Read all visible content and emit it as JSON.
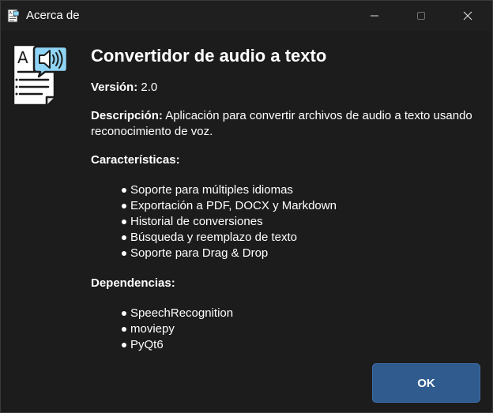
{
  "window": {
    "title": "Acerca de"
  },
  "about": {
    "app_name": "Convertidor de audio a texto",
    "version_label": "Versión:",
    "version_value": "2.0",
    "description_label": "Descripción:",
    "description_text": "Aplicación para convertir archivos de audio a texto usando reconocimiento de voz.",
    "features_title": "Características:",
    "features": [
      "Soporte para múltiples idiomas",
      "Exportación a PDF, DOCX y Markdown",
      "Historial de conversiones",
      "Búsqueda y reemplazo de texto",
      "Soporte para Drag & Drop"
    ],
    "dependencies_title": "Dependencias:",
    "dependencies": [
      "SpeechRecognition",
      "moviepy",
      "PyQt6"
    ]
  },
  "buttons": {
    "ok_label": "OK"
  },
  "icons": {
    "app": "document-speaker-icon",
    "minimize": "minimize-icon",
    "maximize": "maximize-icon",
    "close": "close-icon"
  },
  "colors": {
    "background": "#1c1c1c",
    "ok_button": "#2f5b8e",
    "logo_speaker": "#8fd3f5"
  }
}
